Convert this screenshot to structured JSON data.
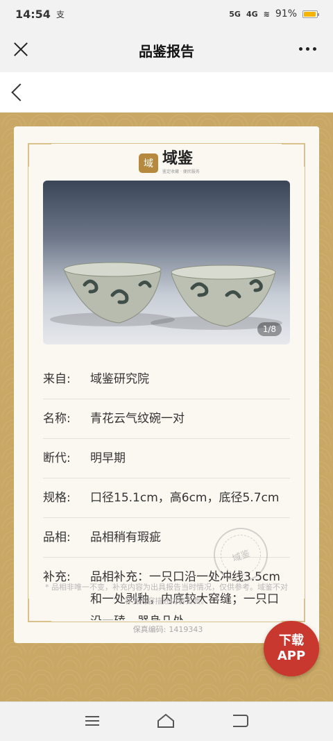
{
  "status": {
    "time": "14:54",
    "carrier": "支",
    "signal1": "5G",
    "signal2": "4G",
    "battery": "91%",
    "battery_color": "#f5b400"
  },
  "header": {
    "title": "品鉴报告"
  },
  "card": {
    "logo_mark": "域",
    "logo_name": "域鉴",
    "logo_tagline": "鉴定收藏 · 便民服务",
    "photo_counter": "1/8",
    "rows": [
      {
        "key": "来自:",
        "value": "域鉴研究院"
      },
      {
        "key": "名称:",
        "value": "青花云气纹碗一对"
      },
      {
        "key": "断代:",
        "value": "明早期"
      },
      {
        "key": "规格:",
        "value": "口径15.1cm，高6cm，底径5.7cm"
      },
      {
        "key": "品相:",
        "value": "品相稍有瑕疵"
      },
      {
        "key": "补充:",
        "value": "品相补充：一只口沿一处冲线3.5cm和一处剥釉，内底较大窑缝；一只口沿一磕，器身几处"
      }
    ],
    "note": "* 品相非唯一不变，补充内容为出具报告当时情况，仅供参考。域鉴不对补充内容描述内容负责。",
    "seal_text": "域鉴",
    "code_label": "保真编码:",
    "code_value": "1419343"
  },
  "app_button": {
    "line1": "下载",
    "line2": "APP",
    "color": "#c9382e"
  },
  "accent_color": "#c9a764"
}
